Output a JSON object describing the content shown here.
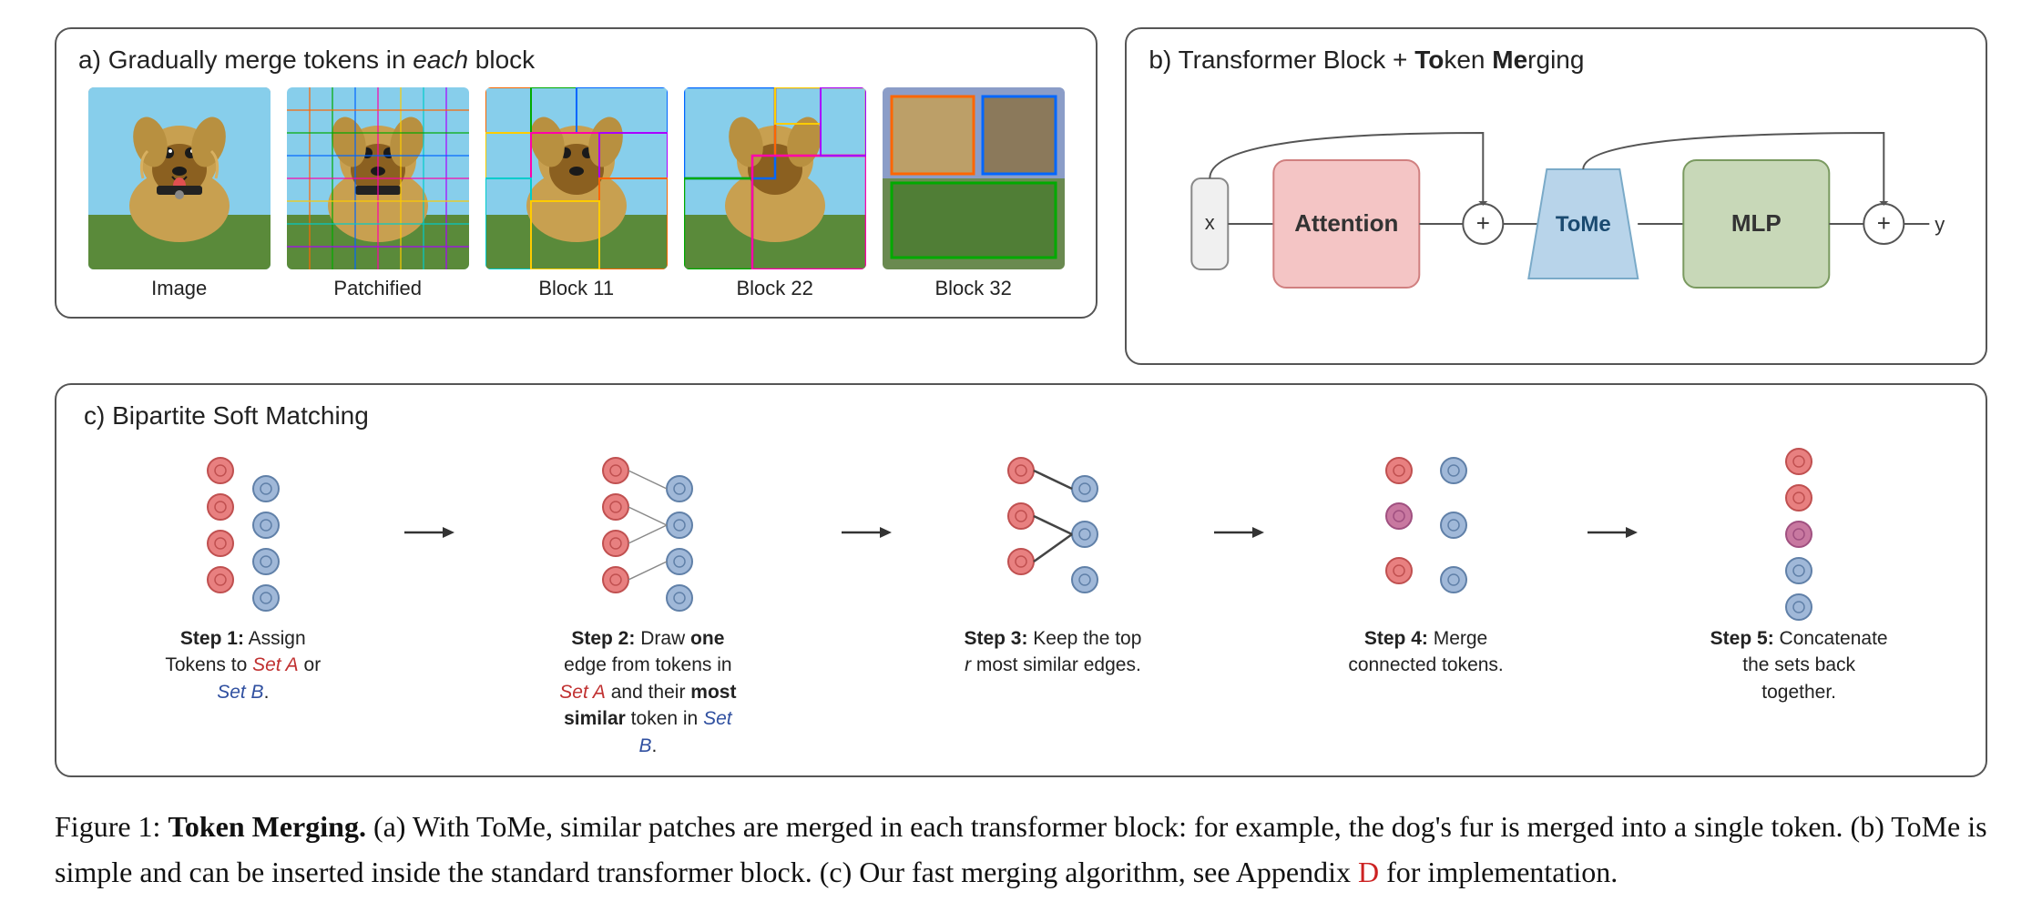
{
  "panel_a": {
    "label": "a)",
    "title": "Gradually merge tokens in ",
    "title_italic": "each",
    "title_end": " block",
    "images": [
      {
        "caption": "Image"
      },
      {
        "caption": "Patchified"
      },
      {
        "caption": "Block 11"
      },
      {
        "caption": "Block 22"
      },
      {
        "caption": "Block 32"
      }
    ]
  },
  "panel_b": {
    "label": "b)",
    "title": "Transformer Block + ",
    "title_bold": "To",
    "title_bold2": "ken ",
    "title_bold3": "Me",
    "title_end": "rging",
    "x_label": "x",
    "y_label": "y",
    "attention_label": "Attention",
    "tome_label": "ToMe",
    "mlp_label": "MLP",
    "plus": "+"
  },
  "panel_c": {
    "label": "c)",
    "title": "Bipartite Soft Matching",
    "steps": [
      {
        "id": "step1",
        "label_bold": "Step 1:",
        "label_rest": " Assign Tokens to ",
        "set_a": "Set A",
        "label_mid": " or ",
        "set_b": "Set B",
        "label_end": "."
      },
      {
        "id": "step2",
        "label_bold": "Step 2:",
        "label_rest": " Draw ",
        "label_bold2": "one",
        "label_rest2": " edge from tokens in ",
        "set_a": "Set A",
        "label_rest3": " and their ",
        "label_bold3": "most similar",
        "label_rest4": " token in ",
        "set_b": "Set B",
        "label_end": "."
      },
      {
        "id": "step3",
        "label_bold": "Step 3:",
        "label_rest": " Keep the top ",
        "label_italic": "r",
        "label_end": " most similar edges."
      },
      {
        "id": "step4",
        "label_bold": "Step 4:",
        "label_rest": " Merge connected tokens."
      },
      {
        "id": "step5",
        "label_bold": "Step 5:",
        "label_rest": " Concatenate the sets back together."
      }
    ]
  },
  "figure_caption": {
    "prefix": "Figure 1: ",
    "bold_part": "Token Merging.",
    "text": " (a) With ToMe, similar patches are merged in each transformer block: for example, the dog's fur is merged into a single token. (b) ToMe is simple and can be inserted inside the standard transformer block. (c) Our fast merging algorithm, see Appendix ",
    "red_letter": "D",
    "suffix": " for implementation."
  },
  "colors": {
    "accent_red": "#C03030",
    "accent_blue": "#3050A0",
    "attention_bg": "#F4C5C5",
    "tome_bg": "#B8D4EA",
    "mlp_bg": "#C8D8B8",
    "dot_red": "#E88080",
    "dot_blue": "#A0B8D8",
    "dot_merged": "#C878A0"
  }
}
